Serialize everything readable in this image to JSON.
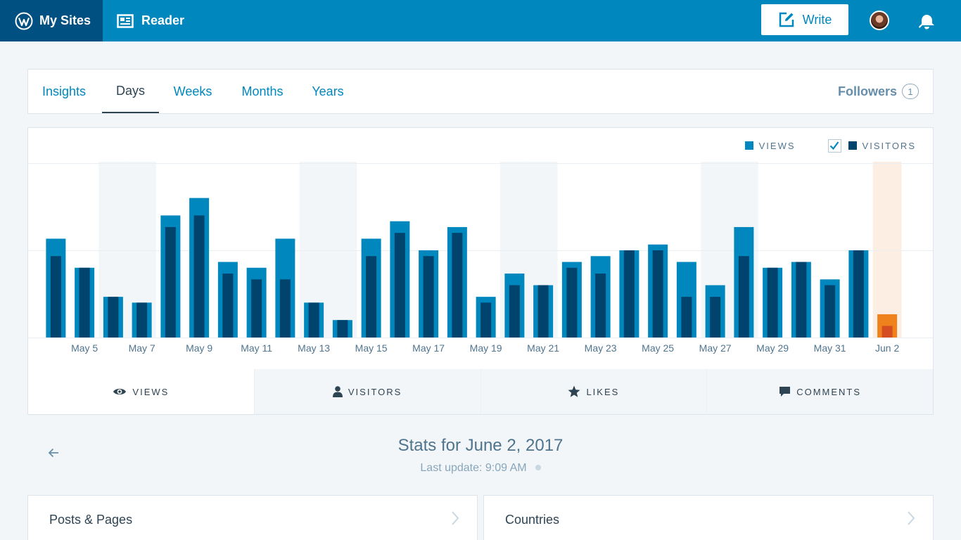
{
  "masterbar": {
    "my_sites_label": "My Sites",
    "reader_label": "Reader",
    "write_label": "Write"
  },
  "period_tabs": [
    {
      "label": "Insights",
      "active": false
    },
    {
      "label": "Days",
      "active": true
    },
    {
      "label": "Weeks",
      "active": false
    },
    {
      "label": "Months",
      "active": false
    },
    {
      "label": "Years",
      "active": false
    }
  ],
  "followers": {
    "label": "Followers",
    "count": "1"
  },
  "legend": {
    "views_label": "VIEWS",
    "visitors_label": "VISITORS",
    "visitors_checked": true
  },
  "colors": {
    "brand": "#0087be",
    "views": "#0087be",
    "visitors": "#00436d",
    "selected_views": "#f0821e",
    "selected_visitors": "#d54e21",
    "selected_bg": "#fdeee3",
    "weekend_bg": "#f3f6f8"
  },
  "chart_data": {
    "type": "bar",
    "categories": [
      "May 4",
      "May 5",
      "May 6",
      "May 7",
      "May 8",
      "May 9",
      "May 10",
      "May 11",
      "May 12",
      "May 13",
      "May 14",
      "May 15",
      "May 16",
      "May 17",
      "May 18",
      "May 19",
      "May 20",
      "May 21",
      "May 22",
      "May 23",
      "May 24",
      "May 25",
      "May 26",
      "May 27",
      "May 28",
      "May 29",
      "May 30",
      "May 31",
      "Jun 1",
      "Jun 2"
    ],
    "tick_labels": [
      "May 5",
      "May 7",
      "May 9",
      "May 11",
      "May 13",
      "May 15",
      "May 17",
      "May 19",
      "May 21",
      "May 23",
      "May 25",
      "May 27",
      "May 29",
      "May 31",
      "Jun 2"
    ],
    "series": [
      {
        "name": "VIEWS",
        "values": [
          17,
          12,
          7,
          6,
          21,
          24,
          13,
          12,
          17,
          6,
          3,
          17,
          20,
          15,
          19,
          7,
          11,
          9,
          13,
          14,
          15,
          16,
          13,
          9,
          19,
          12,
          13,
          10,
          15,
          4
        ]
      },
      {
        "name": "VISITORS",
        "values": [
          14,
          12,
          7,
          6,
          19,
          21,
          11,
          10,
          10,
          6,
          3,
          14,
          18,
          14,
          18,
          6,
          9,
          9,
          12,
          11,
          15,
          15,
          7,
          7,
          14,
          12,
          13,
          9,
          15,
          2
        ]
      }
    ],
    "weekend_indices": [
      2,
      3,
      9,
      10,
      16,
      17,
      23,
      24
    ],
    "selected_index": 29,
    "ylim": [
      0,
      30
    ],
    "grid": true
  },
  "chart_tabs": [
    {
      "label": "VIEWS",
      "icon": "eye-icon",
      "active": true
    },
    {
      "label": "VISITORS",
      "icon": "person-icon",
      "active": false
    },
    {
      "label": "LIKES",
      "icon": "star-icon",
      "active": false
    },
    {
      "label": "COMMENTS",
      "icon": "comment-icon",
      "active": false
    }
  ],
  "stats": {
    "title": "Stats for June 2, 2017",
    "last_update": "Last update: 9:09 AM"
  },
  "modules": [
    {
      "label": "Posts & Pages"
    },
    {
      "label": "Countries"
    }
  ]
}
